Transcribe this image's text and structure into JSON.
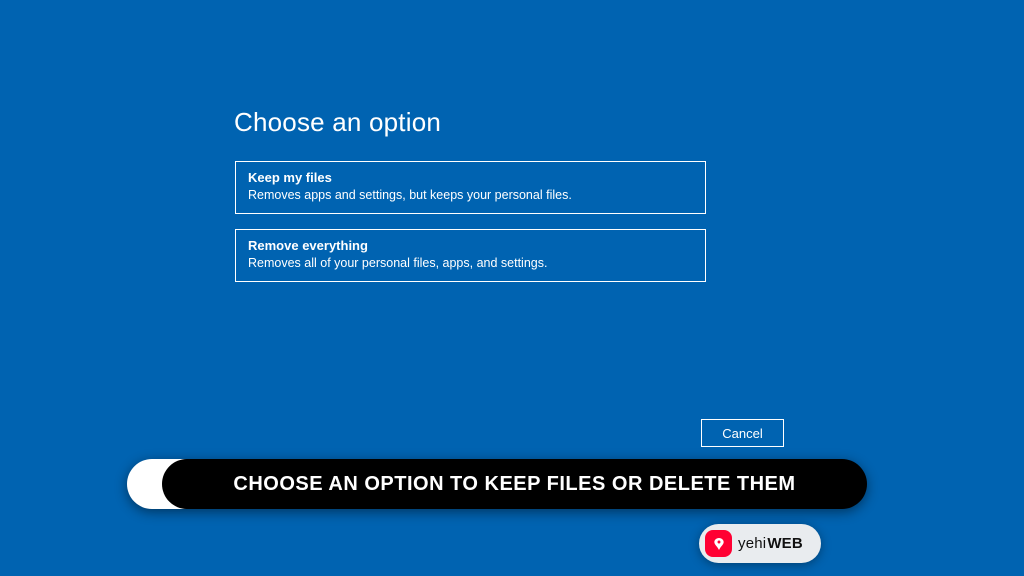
{
  "title": "Choose an option",
  "options": [
    {
      "title": "Keep my files",
      "desc": "Removes apps and settings, but keeps your personal files."
    },
    {
      "title": "Remove everything",
      "desc": "Removes all of your personal files, apps, and settings."
    }
  ],
  "cancel_label": "Cancel",
  "caption": {
    "bold": "CHOOSE AN OPTION",
    "rest": "TO KEEP FILES OR DELETE THEM"
  },
  "badge": {
    "prefix": "yehi",
    "suffix": "WEB"
  },
  "colors": {
    "background": "#0063B1",
    "border": "#ffffff",
    "caption_bg": "#000000",
    "caption_accent": "#ffffff",
    "badge_bg": "#e9ecef",
    "badge_icon": "#ff0033"
  }
}
